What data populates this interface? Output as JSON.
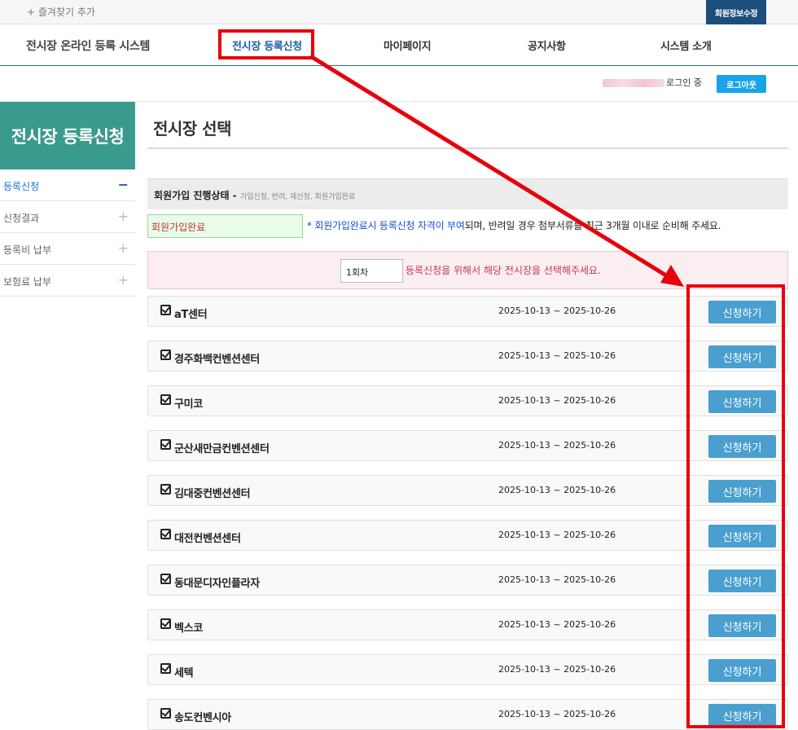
{
  "util_bar": {
    "favorite_label": "+ 즐겨찾기 추가",
    "member_edit_label": "회원정보수정"
  },
  "gnb": {
    "brand": "전시장 온라인 등록 시스템",
    "menus": [
      {
        "label": "전시장 등록신청",
        "active": true
      },
      {
        "label": "마이페이지",
        "active": false
      },
      {
        "label": "공지사항",
        "active": false
      },
      {
        "label": "시스템 소개",
        "active": false
      }
    ]
  },
  "login_bar": {
    "status": "로그인 중",
    "logout_label": "로그아웃"
  },
  "side_nav": {
    "title": "전시장 등록신청",
    "items": [
      {
        "label": "등록신청",
        "sign": "−",
        "active": true
      },
      {
        "label": "신청결과",
        "sign": "+",
        "active": false
      },
      {
        "label": "등록비 납부",
        "sign": "+",
        "active": false
      },
      {
        "label": "보험료 납부",
        "sign": "+",
        "active": false
      }
    ]
  },
  "content": {
    "page_title": "전시장 선택",
    "status_header": "회원가입 진행상태 -",
    "status_header_sub": "가입신청, 반려, 재신청, 회원가입완료",
    "status_value": "회원가입완료",
    "status_note_blue": "* 회원가입완료시 등록신청 자격이 부여",
    "status_note_rest": "되며, 반려일 경우 첨부서류를 최근 3개월 이내로 순비해 주세요.",
    "round_select": "1회차",
    "round_message": "등록신청을 위해서 해당 전시장을 선택해주세요.",
    "apply_label": "신청하기",
    "venues": [
      {
        "name": "aT센터",
        "period": "2025-10-13 ~ 2025-10-26"
      },
      {
        "name": "경주화백컨벤션센터",
        "period": "2025-10-13 ~ 2025-10-26"
      },
      {
        "name": "구미코",
        "period": "2025-10-13 ~ 2025-10-26"
      },
      {
        "name": "군산새만금컨벤션센터",
        "period": "2025-10-13 ~ 2025-10-26"
      },
      {
        "name": "김대중컨벤션센터",
        "period": "2025-10-13 ~ 2025-10-26"
      },
      {
        "name": "대전컨벤션센터",
        "period": "2025-10-13 ~ 2025-10-26"
      },
      {
        "name": "동대문디자인플라자",
        "period": "2025-10-13 ~ 2025-10-26"
      },
      {
        "name": "벡스코",
        "period": "2025-10-13 ~ 2025-10-26"
      },
      {
        "name": "세텍",
        "period": "2025-10-13 ~ 2025-10-26"
      },
      {
        "name": "송도컨벤시아",
        "period": "2025-10-13 ~ 2025-10-26"
      }
    ]
  },
  "colors": {
    "annotation_red": "#e8000b",
    "side_title_bg": "#3a9a8d",
    "apply_button_bg": "#4a9fcf",
    "logout_button_bg": "#1aa3e8",
    "member_edit_bg": "#1c4e7c"
  }
}
